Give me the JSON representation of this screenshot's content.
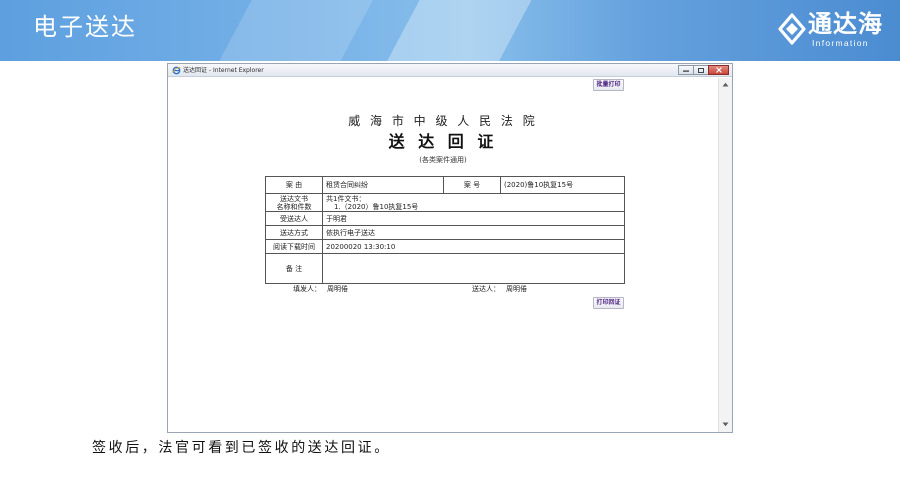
{
  "banner": {
    "title": "电子送达",
    "logo_text": "通达海",
    "logo_subtitle": "Information"
  },
  "window": {
    "title": "送达回证 - Internet Explorer"
  },
  "document": {
    "batch_print_label": "批量打印",
    "court_name": "威 海 市 中 级 人 民 法 院",
    "doc_title": "送 达 回 证",
    "doc_subtitle": "(各类案件通用)",
    "table": {
      "case_cause_label": "案 由",
      "case_cause": "租赁合同纠纷",
      "case_no_label": "案 号",
      "case_no": "(2020)鲁10执复15号",
      "documents_label_line1": "送达文书",
      "documents_label_line2": "名称和件数",
      "documents_count": "共1件文书：",
      "documents_item": "1.（2020）鲁10执复15号",
      "recipient_label": "受送达人",
      "recipient": "于明君",
      "method_label": "送达方式",
      "method": "依执行电子送达",
      "read_time_label": "阅读下载时间",
      "read_time": "20200020 13:30:10",
      "remark_label": "备 注"
    },
    "filler_label": "填发人：",
    "filler_name": "周明倦",
    "server_label": "送达人：",
    "server_name": "周明倦",
    "print_receipt_label": "打印回证"
  },
  "caption": "签收后，法官可看到已签收的送达回证。",
  "icons": {
    "logo": "tongdahai-logo-icon",
    "browser": "ie-icon",
    "minimize": "minimize-icon",
    "maximize": "maximize-icon",
    "close": "close-icon",
    "scroll_up": "scroll-up-icon",
    "scroll_down": "scroll-down-icon"
  },
  "colors": {
    "banner_text": "#ffffff",
    "button_text": "#4a2380",
    "close_button": "#c8453b"
  }
}
